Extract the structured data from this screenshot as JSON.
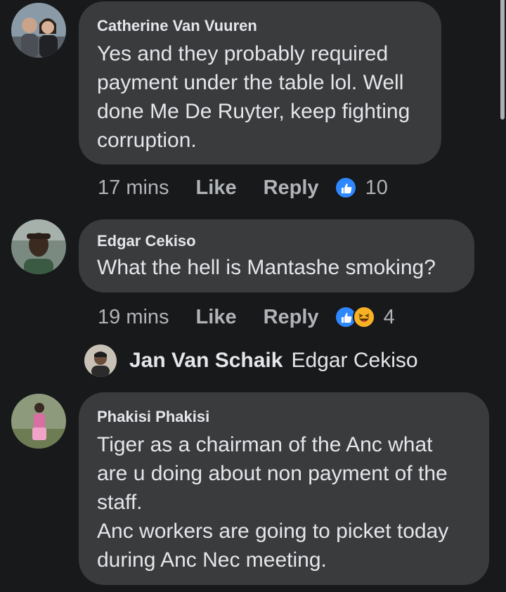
{
  "comments": [
    {
      "author": "Catherine Van Vuuren",
      "lines": [
        "Yes and they probably required",
        "payment under the table lol. Well",
        "done Me De Ruyter, keep fighting",
        "corruption."
      ],
      "time": "17 mins",
      "like_label": "Like",
      "reply_label": "Reply",
      "reaction_count": "10",
      "reactions": [
        "like-icon"
      ]
    },
    {
      "author": "Edgar Cekiso",
      "lines": [
        "What the hell is Mantashe smoking?"
      ],
      "time": "19 mins",
      "like_label": "Like",
      "reply_label": "Reply",
      "reaction_count": "4",
      "reactions": [
        "like-icon",
        "haha-icon"
      ]
    },
    {
      "author": "Phakisi Phakisi",
      "lines": [
        "Tiger as a chairman of the Anc what",
        "are u doing about non payment of the",
        "staff.",
        "Anc workers are going to picket today",
        "during Anc Nec meeting."
      ]
    }
  ],
  "reply_preview": {
    "author": "Jan Van Schaik",
    "mention": "Edgar Cekiso"
  },
  "colors": {
    "background": "#18191a",
    "bubble": "#3a3b3c",
    "text": "#e4e6eb",
    "meta": "#b0b3b8",
    "like_blue": "#2d88ff",
    "haha_yellow": "#f7b125"
  }
}
